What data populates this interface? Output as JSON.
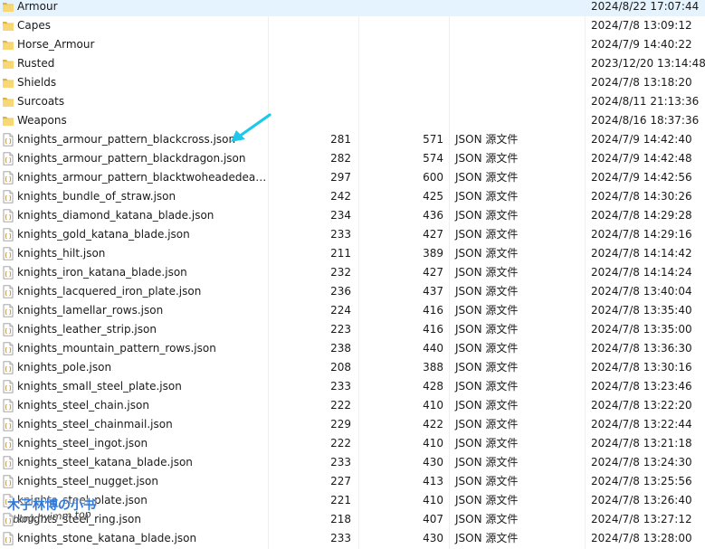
{
  "colors": {
    "folder": "#f8d775",
    "folder_dark": "#e3b341",
    "arrow": "#1ec8e8",
    "watermark": "#2f78d8"
  },
  "icons": {
    "folder": "folder-icon",
    "file": "json-file-icon",
    "annotation": "arrow-annotation-icon"
  },
  "watermark": {
    "line1": "木子林博の小书",
    "line2": "blog.hyimm.top"
  },
  "folders": [
    {
      "name": "Armour",
      "date": "2024/8/22 17:07:44"
    },
    {
      "name": "Capes",
      "date": "2024/7/8 13:09:12"
    },
    {
      "name": "Horse_Armour",
      "date": "2024/7/9 14:40:22"
    },
    {
      "name": "Rusted",
      "date": "2023/12/20 13:14:48"
    },
    {
      "name": "Shields",
      "date": "2024/7/8 13:18:20"
    },
    {
      "name": "Surcoats",
      "date": "2024/8/11 21:13:36"
    },
    {
      "name": "Weapons",
      "date": "2024/8/16 18:37:36"
    }
  ],
  "files": [
    {
      "name": "knights_armour_pattern_blackcross.json",
      "a": "281",
      "b": "571",
      "type": "JSON 源文件",
      "date": "2024/7/9 14:42:40"
    },
    {
      "name": "knights_armour_pattern_blackdragon.json",
      "a": "282",
      "b": "574",
      "type": "JSON 源文件",
      "date": "2024/7/9 14:42:48"
    },
    {
      "name": "knights_armour_pattern_blacktwoheadedeagl...",
      "a": "297",
      "b": "600",
      "type": "JSON 源文件",
      "date": "2024/7/9 14:42:56"
    },
    {
      "name": "knights_bundle_of_straw.json",
      "a": "242",
      "b": "425",
      "type": "JSON 源文件",
      "date": "2024/7/8 14:30:26"
    },
    {
      "name": "knights_diamond_katana_blade.json",
      "a": "234",
      "b": "436",
      "type": "JSON 源文件",
      "date": "2024/7/8 14:29:28"
    },
    {
      "name": "knights_gold_katana_blade.json",
      "a": "233",
      "b": "427",
      "type": "JSON 源文件",
      "date": "2024/7/8 14:29:16"
    },
    {
      "name": "knights_hilt.json",
      "a": "211",
      "b": "389",
      "type": "JSON 源文件",
      "date": "2024/7/8 14:14:42"
    },
    {
      "name": "knights_iron_katana_blade.json",
      "a": "232",
      "b": "427",
      "type": "JSON 源文件",
      "date": "2024/7/8 14:14:24"
    },
    {
      "name": "knights_lacquered_iron_plate.json",
      "a": "236",
      "b": "437",
      "type": "JSON 源文件",
      "date": "2024/7/8 13:40:04"
    },
    {
      "name": "knights_lamellar_rows.json",
      "a": "224",
      "b": "416",
      "type": "JSON 源文件",
      "date": "2024/7/8 13:35:40"
    },
    {
      "name": "knights_leather_strip.json",
      "a": "223",
      "b": "416",
      "type": "JSON 源文件",
      "date": "2024/7/8 13:35:00"
    },
    {
      "name": "knights_mountain_pattern_rows.json",
      "a": "238",
      "b": "440",
      "type": "JSON 源文件",
      "date": "2024/7/8 13:36:30"
    },
    {
      "name": "knights_pole.json",
      "a": "208",
      "b": "388",
      "type": "JSON 源文件",
      "date": "2024/7/8 13:30:16"
    },
    {
      "name": "knights_small_steel_plate.json",
      "a": "233",
      "b": "428",
      "type": "JSON 源文件",
      "date": "2024/7/8 13:23:46"
    },
    {
      "name": "knights_steel_chain.json",
      "a": "222",
      "b": "410",
      "type": "JSON 源文件",
      "date": "2024/7/8 13:22:20"
    },
    {
      "name": "knights_steel_chainmail.json",
      "a": "229",
      "b": "422",
      "type": "JSON 源文件",
      "date": "2024/7/8 13:22:44"
    },
    {
      "name": "knights_steel_ingot.json",
      "a": "222",
      "b": "410",
      "type": "JSON 源文件",
      "date": "2024/7/8 13:21:18"
    },
    {
      "name": "knights_steel_katana_blade.json",
      "a": "233",
      "b": "430",
      "type": "JSON 源文件",
      "date": "2024/7/8 13:24:30"
    },
    {
      "name": "knights_steel_nugget.json",
      "a": "227",
      "b": "413",
      "type": "JSON 源文件",
      "date": "2024/7/8 13:25:56"
    },
    {
      "name": "knights_steel_plate.json",
      "a": "221",
      "b": "410",
      "type": "JSON 源文件",
      "date": "2024/7/8 13:26:40"
    },
    {
      "name": "knights_steel_ring.json",
      "a": "218",
      "b": "407",
      "type": "JSON 源文件",
      "date": "2024/7/8 13:27:12"
    },
    {
      "name": "knights_stone_katana_blade.json",
      "a": "233",
      "b": "430",
      "type": "JSON 源文件",
      "date": "2024/7/8 13:28:00"
    }
  ]
}
